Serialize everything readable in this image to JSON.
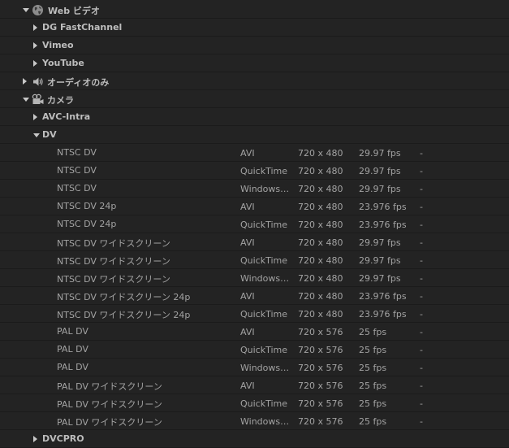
{
  "groups": {
    "web_video": {
      "label": "Web ビデオ",
      "icon": "globe-icon"
    },
    "dg_fastchannel": {
      "label": "DG FastChannel"
    },
    "vimeo": {
      "label": "Vimeo"
    },
    "youtube": {
      "label": "YouTube"
    },
    "audio_only": {
      "label": "オーディオのみ",
      "icon": "speaker-icon"
    },
    "camera": {
      "label": "カメラ",
      "icon": "camcorder-icon"
    },
    "avc_intra": {
      "label": "AVC-Intra"
    },
    "dv": {
      "label": "DV"
    },
    "dvcpro": {
      "label": "DVCPRO"
    }
  },
  "presets": [
    {
      "name": "NTSC DV",
      "format": "AVI",
      "size": "720 x 480",
      "fps": "29.97 fps",
      "extra": "-"
    },
    {
      "name": "NTSC DV",
      "format": "QuickTime",
      "size": "720 x 480",
      "fps": "29.97 fps",
      "extra": "-"
    },
    {
      "name": "NTSC DV",
      "format": "Windows…",
      "size": "720 x 480",
      "fps": "29.97 fps",
      "extra": "-"
    },
    {
      "name": "NTSC DV 24p",
      "format": "AVI",
      "size": "720 x 480",
      "fps": "23.976 fps",
      "extra": "-"
    },
    {
      "name": "NTSC DV 24p",
      "format": "QuickTime",
      "size": "720 x 480",
      "fps": "23.976 fps",
      "extra": "-"
    },
    {
      "name": "NTSC DV ワイドスクリーン",
      "format": "AVI",
      "size": "720 x 480",
      "fps": "29.97 fps",
      "extra": "-"
    },
    {
      "name": "NTSC DV ワイドスクリーン",
      "format": "QuickTime",
      "size": "720 x 480",
      "fps": "29.97 fps",
      "extra": "-"
    },
    {
      "name": "NTSC DV ワイドスクリーン",
      "format": "Windows…",
      "size": "720 x 480",
      "fps": "29.97 fps",
      "extra": "-"
    },
    {
      "name": "NTSC DV ワイドスクリーン 24p",
      "format": "AVI",
      "size": "720 x 480",
      "fps": "23.976 fps",
      "extra": "-"
    },
    {
      "name": "NTSC DV ワイドスクリーン 24p",
      "format": "QuickTime",
      "size": "720 x 480",
      "fps": "23.976 fps",
      "extra": "-"
    },
    {
      "name": "PAL DV",
      "format": "AVI",
      "size": "720 x 576",
      "fps": "25 fps",
      "extra": "-"
    },
    {
      "name": "PAL DV",
      "format": "QuickTime",
      "size": "720 x 576",
      "fps": "25 fps",
      "extra": "-"
    },
    {
      "name": "PAL DV",
      "format": "Windows…",
      "size": "720 x 576",
      "fps": "25 fps",
      "extra": "-"
    },
    {
      "name": "PAL DV ワイドスクリーン",
      "format": "AVI",
      "size": "720 x 576",
      "fps": "25 fps",
      "extra": "-"
    },
    {
      "name": "PAL DV ワイドスクリーン",
      "format": "QuickTime",
      "size": "720 x 576",
      "fps": "25 fps",
      "extra": "-"
    },
    {
      "name": "PAL DV ワイドスクリーン",
      "format": "Windows…",
      "size": "720 x 576",
      "fps": "25 fps",
      "extra": "-"
    }
  ]
}
